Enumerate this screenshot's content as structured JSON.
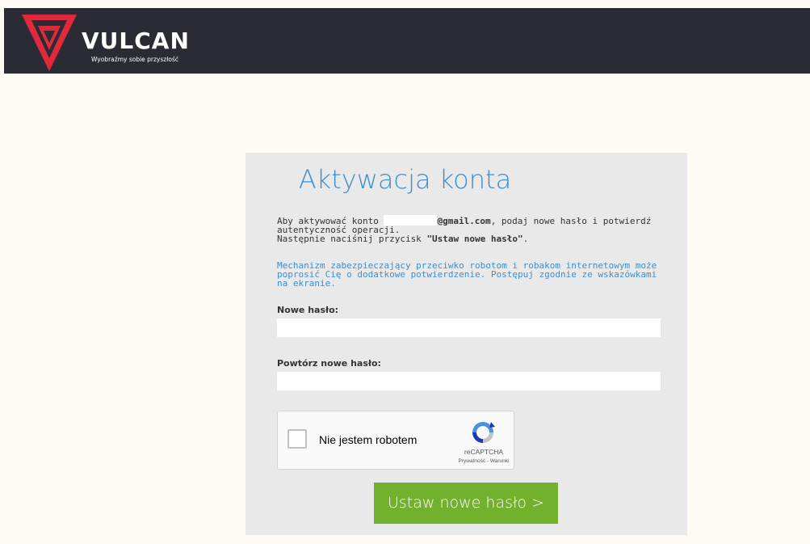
{
  "header": {
    "brand_name": "VULCAN",
    "tagline": "Wyobraźmy sobie przyszłość",
    "logo_icon": "vulcan-v-shield-icon",
    "background_color": "#2b2b35",
    "logo_color": "#e0293b"
  },
  "card": {
    "title": "Aktywacja konta",
    "intro": {
      "text_before_email": "Aby aktywować konto ",
      "email_domain": "@gmail.com",
      "text_after_email": ", podaj nowe hasło i potwierdź autentyczność operacji.",
      "next_step_text": "Następnie naciśnij przycisk ",
      "button_reference": "\"Ustaw nowe hasło\"",
      "period": "."
    },
    "notice": "Mechanizm zabezpieczający przeciwko robotom i robakom internetowym może poprosić Cię o dodatkowe potwierdzenie. Postępuj zgodnie ze wskazówkami na ekranie.",
    "new_password": {
      "label": "Nowe hasło:",
      "value": ""
    },
    "repeat_password": {
      "label": "Powtórz nowe hasło:",
      "value": ""
    },
    "recaptcha": {
      "checkbox_label": "Nie jestem robotem",
      "checked": false,
      "brand": "reCAPTCHA",
      "links": "Prywatność - Warunki",
      "logo_icon": "recaptcha-logo-icon"
    },
    "submit_label": "Ustaw nowe hasło >",
    "title_color": "#3d8ecf",
    "accent_button_color": "#72b12e"
  }
}
